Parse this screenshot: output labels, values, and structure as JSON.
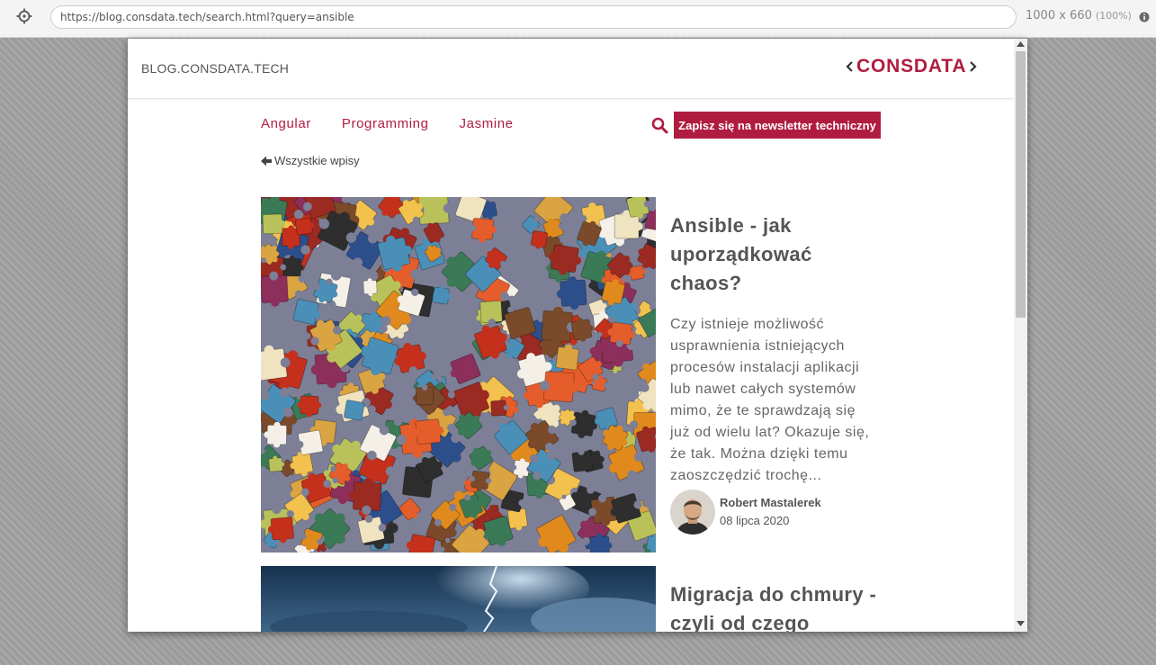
{
  "browser": {
    "url": "https://blog.consdata.tech/search.html?query=ansible",
    "dimensions": "1000 x 660",
    "zoom": "(100%)"
  },
  "site": {
    "name": "BLOG.CONSDATA.TECH",
    "logo_text": "CONSDATA",
    "brand_color": "#b01c40"
  },
  "nav": {
    "links": [
      "Angular",
      "Programming",
      "Jasmine"
    ],
    "newsletter_label": "Zapisz się na newsletter techniczny",
    "back_label": "Wszystkie wpisy"
  },
  "posts": [
    {
      "title": "Ansible - jak uporządkować chaos?",
      "excerpt": "Czy istnieje możliwość usprawnienia istniejących procesów instalacji aplikacji lub nawet całych systemów mimo, że te sprawdzają się już od wielu lat? Okazuje się, że tak. Można dzięki temu zaoszczędzić trochę...",
      "author": "Robert Mastalerek",
      "date": "08 lipca 2020",
      "image": "puzzle-pieces"
    },
    {
      "title": "Migracja do chmury - czyli od czego",
      "image": "storm-clouds"
    }
  ]
}
